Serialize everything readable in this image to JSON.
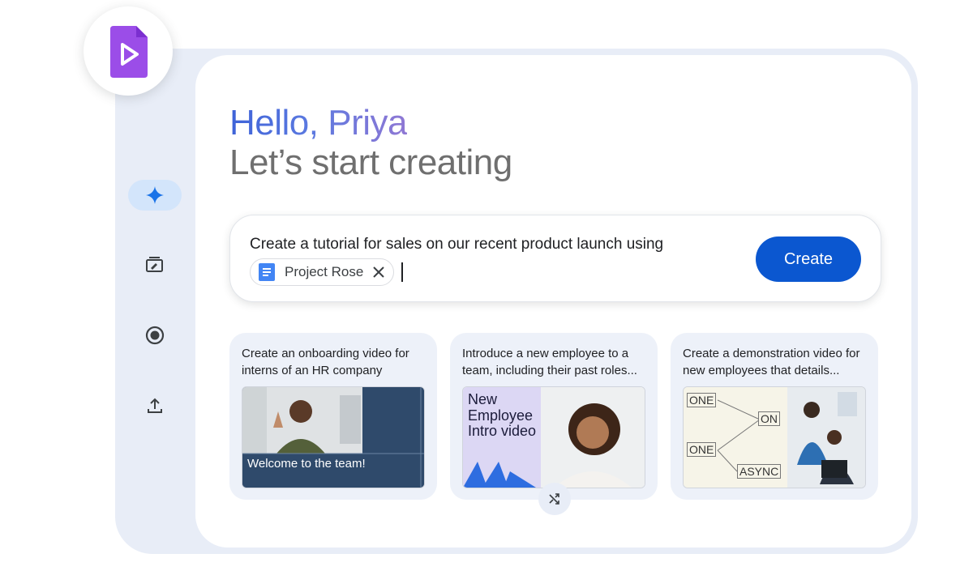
{
  "app": {
    "icon": "google-vids-icon",
    "brand_color": "#9b4de8"
  },
  "rail": {
    "items": [
      {
        "icon": "sparkle-icon",
        "active": true
      },
      {
        "icon": "media-edit-icon",
        "active": false
      },
      {
        "icon": "record-icon",
        "active": false
      },
      {
        "icon": "upload-icon",
        "active": false
      }
    ]
  },
  "greeting": {
    "hello": "Hello, Priya",
    "subtitle": "Let’s start creating"
  },
  "prompt": {
    "text": "Create a tutorial for sales on our recent product launch using",
    "chip_label": "Project Rose",
    "chip_icon": "google-docs-icon",
    "create_label": "Create"
  },
  "cards": [
    {
      "text": "Create an onboarding video for interns of an HR company",
      "thumb_caption": "Welcome to the team!"
    },
    {
      "text": "Introduce a new employee to a team, including their past roles...",
      "thumb_title": "New Employee Intro video"
    },
    {
      "text": "Create a demonstration video for new employees that details...",
      "diagram_labels": [
        "ONE",
        "ON",
        "ONE",
        "ASYNC"
      ]
    }
  ],
  "shuffle_icon": "shuffle-icon",
  "colors": {
    "accent": "#0b57d0",
    "frame_bg": "#e8edf7",
    "rail_active": "#d3e5fb"
  }
}
